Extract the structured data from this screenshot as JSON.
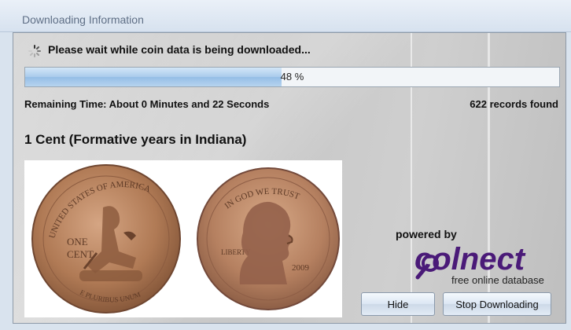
{
  "window": {
    "title": "Downloading Information"
  },
  "status": {
    "wait_text": "Please wait while coin data is being downloaded...",
    "progress_fraction": 0.48,
    "progress_label": "48 %",
    "remaining_time": "Remaining Time: About 0 Minutes and 22 Seconds",
    "records_found": "622 records found"
  },
  "coin": {
    "title": "1 Cent (Formative years in Indiana)",
    "obverse_inscription": "IN GOD WE TRUST",
    "obverse_liberty": "LIBERTY",
    "obverse_year": "2009",
    "reverse_inscription": "UNITED STATES OF AMERICA",
    "reverse_denomination_line1": "ONE",
    "reverse_denomination_line2": "CENT",
    "reverse_motto": "E PLURIBUS UNUM"
  },
  "logo": {
    "powered_by": "powered by",
    "brand": "colnect",
    "tagline": "free online database"
  },
  "buttons": {
    "hide_label": "Hide",
    "stop_label": "Stop Downloading"
  },
  "colors": {
    "brand_purple": "#4a1a78",
    "progress_fill": "#a9cbec",
    "copper": "#b07a55"
  }
}
